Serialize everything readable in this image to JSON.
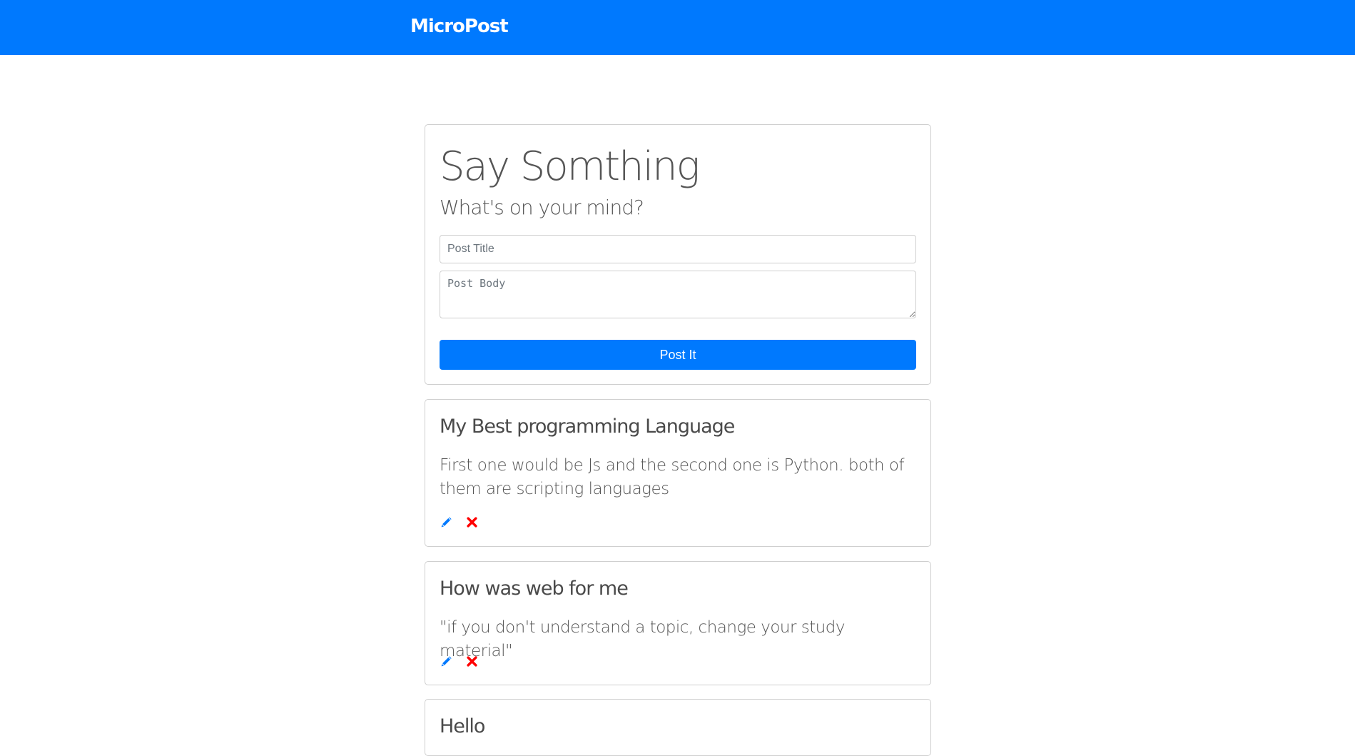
{
  "navbar": {
    "brand": "MicroPost",
    "bg_color": "#0079fe"
  },
  "form": {
    "heading": "Say Somthing",
    "lead": "What's on your mind?",
    "title_placeholder": "Post Title",
    "body_placeholder": "Post Body",
    "submit_label": "Post It",
    "button_color": "#0079fe"
  },
  "posts": [
    {
      "title": "My Best programming Language",
      "body": "First one would be Js and the second one is Python. both of them are scripting languages",
      "edit_icon": "pencil-icon",
      "delete_icon": "close-icon"
    },
    {
      "title": "How was web for me",
      "body": "\"if you don't understand a topic, change your study material\"",
      "edit_icon": "pencil-icon",
      "delete_icon": "close-icon"
    },
    {
      "title": "Hello",
      "body": ""
    }
  ],
  "colors": {
    "edit_icon": "#0079fe",
    "delete_icon": "#ff0000"
  }
}
